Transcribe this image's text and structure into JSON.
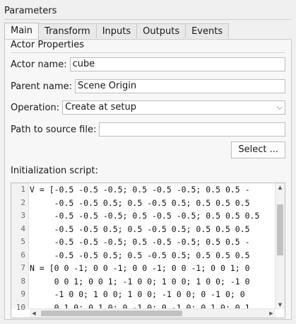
{
  "title": "Parameters",
  "tabs": [
    {
      "label": "Main"
    },
    {
      "label": "Transform"
    },
    {
      "label": "Inputs"
    },
    {
      "label": "Outputs"
    },
    {
      "label": "Events"
    }
  ],
  "actor_properties": {
    "group_title": "Actor Properties",
    "actor_name_label": "Actor name:",
    "actor_name_value": "cube",
    "parent_name_label": "Parent name:",
    "parent_name_value": "Scene Origin",
    "operation_label": "Operation:",
    "operation_value": "Create at setup",
    "path_label": "Path to source file:",
    "path_value": "",
    "browse_label": "Select ..."
  },
  "script": {
    "label": "Initialization script:",
    "lines": [
      {
        "n": "1",
        "text": "V = [-0.5 -0.5 -0.5; 0.5 -0.5 -0.5; 0.5 0.5 -"
      },
      {
        "n": "2",
        "text": "     -0.5 -0.5 0.5; 0.5 -0.5 0.5; 0.5 0.5 0.5"
      },
      {
        "n": "3",
        "text": "     -0.5 -0.5 -0.5; 0.5 -0.5 -0.5; 0.5 0.5 0.5"
      },
      {
        "n": "4",
        "text": "     -0.5 -0.5 0.5; 0.5 -0.5 0.5; 0.5 0.5 0.5"
      },
      {
        "n": "5",
        "text": "     -0.5 -0.5 -0.5; 0.5 -0.5 -0.5; 0.5 0.5 -"
      },
      {
        "n": "6",
        "text": "     -0.5 -0.5 0.5; 0.5 -0.5 0.5; 0.5 0.5 0.5"
      },
      {
        "n": "7",
        "text": "N = [0 0 -1; 0 0 -1; 0 0 -1; 0 0 -1; 0 0 1; 0"
      },
      {
        "n": "8",
        "text": "     0 0 1; 0 0 1; -1 0 0; 1 0 0; 1 0 0; -1 0"
      },
      {
        "n": "9",
        "text": "     -1 0 0; 1 0 0; 1 0 0; -1 0 0; 0 -1 0; 0"
      },
      {
        "n": "10",
        "text": "     0 1 0; 0 1 0; 0 -1 0; 0 -1 0; 0 1 0; 0 1"
      }
    ]
  }
}
